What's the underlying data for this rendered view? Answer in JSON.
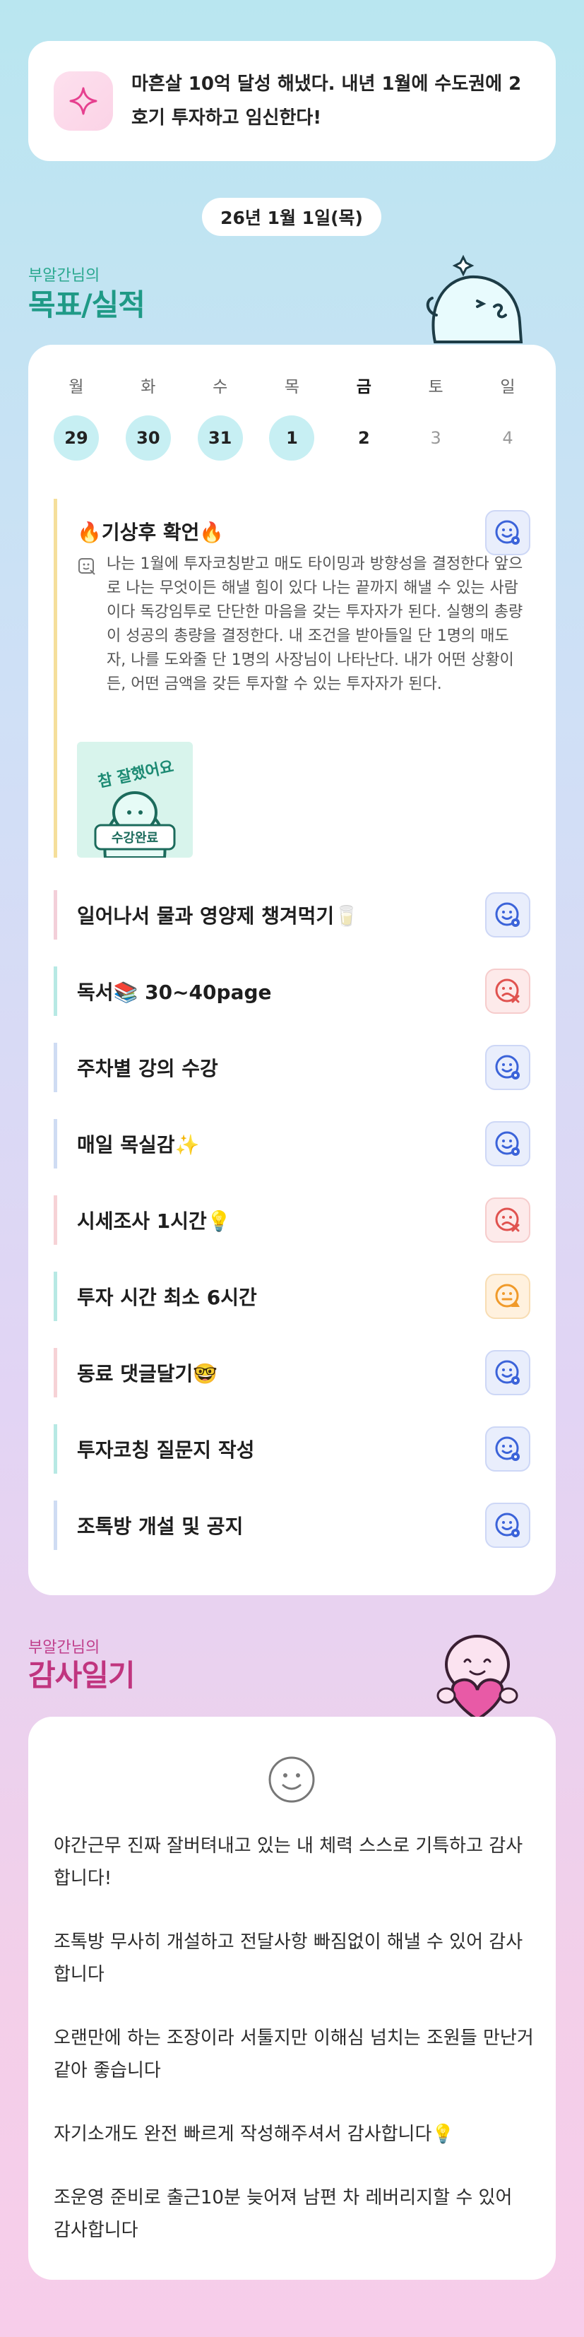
{
  "banner": {
    "icon": "sparkle-icon",
    "text": "마흔살 10억 달성 해냈다. 내년 1월에 수도권에 2호기 투자하고 임신한다!"
  },
  "date": "26년 1월 1일(목)",
  "goals": {
    "subtitle": "부알간님의",
    "title": "목표/실적",
    "week": {
      "days": [
        "월",
        "화",
        "수",
        "목",
        "금",
        "토",
        "일"
      ],
      "dates": [
        "29",
        "30",
        "31",
        "1",
        "2",
        "3",
        "4"
      ]
    },
    "detail": {
      "title": "🔥기상후 확언🔥",
      "note": "나는 1월에 투자코칭받고 매도 타이밍과 방향성을 결정한다 앞으로 나는 무엇이든 해낼 힘이 있다 나는 끝까지 해낼 수 있는 사람이다 독강임투로 단단한 마음을 갖는 투자자가 된다. 실행의 총량이 성공의 총량을 결정한다. 내 조건을 받아들일 단 1명의 매도자, 나를 도와줄 단 1명의 사장님이 나타난다. 내가 어떤 상황이든, 어떤 금액을 갖든 투자할 수 있는 투자자가 된다.",
      "sticker_text_top": "참 잘했어요",
      "sticker_text_bottom": "수강완료",
      "status": "done"
    },
    "items": [
      {
        "label": "일어나서 물과 영양제 챙겨먹기🥛",
        "status": "done",
        "color": "#f3cfd9"
      },
      {
        "label": "독서📚 30~40page",
        "status": "missed",
        "color": "#b7e9e4"
      },
      {
        "label": "주차별 강의 수강",
        "status": "done",
        "color": "#cfdcf3"
      },
      {
        "label": "매일 목실감✨",
        "status": "done",
        "color": "#cfdcf3"
      },
      {
        "label": "시세조사 1시간💡",
        "status": "missed",
        "color": "#f6d2d6"
      },
      {
        "label": "투자 시간 최소 6시간",
        "status": "partial",
        "color": "#b7e9e4"
      },
      {
        "label": "동료 댓글달기🤓",
        "status": "done",
        "color": "#f6d2d6"
      },
      {
        "label": "투자코칭 질문지 작성",
        "status": "done",
        "color": "#b7e9e4"
      },
      {
        "label": "조톡방 개설 및 공지",
        "status": "done",
        "color": "#cfdcf3"
      }
    ]
  },
  "thanks": {
    "subtitle": "부알간님의",
    "title": "감사일기",
    "icon": "smile-icon",
    "entries": [
      "야간근무 진짜 잘버텨내고 있는 내 체력 스스로 기특하고 감사합니다!",
      "조톡방 무사히 개설하고 전달사항 빠짐없이 해낼 수 있어 감사합니다",
      "오랜만에 하는 조장이라 서툴지만 이해심 넘치는 조원들 만난거 같아 좋습니다",
      "자기소개도 완전 빠르게 작성해주셔서 감사합니다💡",
      "조운영 준비로 출근10분 늦어져 남편 차 레버리지할 수 있어 감사합니다"
    ]
  },
  "colors": {
    "goals_title": "#1f9a86",
    "thanks_title": "#c0357f",
    "status_done": "#3b63d9",
    "status_missed": "#e0524f",
    "status_partial": "#f09a2a"
  }
}
